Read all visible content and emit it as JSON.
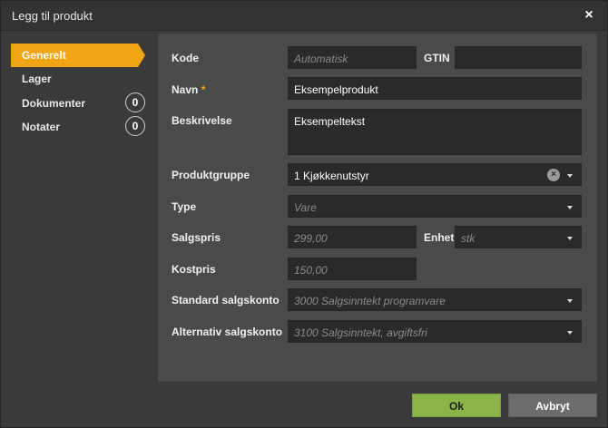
{
  "dialog": {
    "title": "Legg til produkt",
    "close_label": "×"
  },
  "sidebar": {
    "items": [
      {
        "label": "Generelt",
        "active": true
      },
      {
        "label": "Lager"
      },
      {
        "label": "Dokumenter",
        "count": "0"
      },
      {
        "label": "Notater",
        "count": "0"
      }
    ]
  },
  "form": {
    "kode": {
      "label": "Kode",
      "value": "",
      "placeholder": "Automatisk"
    },
    "gtin": {
      "label": "GTIN",
      "value": ""
    },
    "navn": {
      "label": "Navn",
      "required_marker": "*",
      "value": "Eksempelprodukt"
    },
    "beskrivelse": {
      "label": "Beskrivelse",
      "value": "Eksempeltekst"
    },
    "produktgruppe": {
      "label": "Produktgruppe",
      "value": "1 Kjøkkenutstyr",
      "clear_label": "×"
    },
    "type": {
      "label": "Type",
      "value": "",
      "placeholder": "Vare"
    },
    "salgspris": {
      "label": "Salgspris",
      "value": "",
      "placeholder": "299,00"
    },
    "enhet": {
      "label": "Enhet",
      "value": "",
      "placeholder": "stk"
    },
    "kostpris": {
      "label": "Kostpris",
      "value": "",
      "placeholder": "150,00"
    },
    "standard_salgskonto": {
      "label": "Standard salgskonto",
      "value": "",
      "placeholder": "3000 Salgsinntekt programvare"
    },
    "alternativ_salgskonto": {
      "label": "Alternativ salgskonto",
      "value": "",
      "placeholder": "3100 Salgsinntekt, avgiftsfri"
    }
  },
  "footer": {
    "ok_label": "Ok",
    "cancel_label": "Avbryt"
  },
  "colors": {
    "accent": "#f0a515",
    "ok_button": "#8ab448",
    "cancel_button": "#6c6c6c",
    "panel": "#4a4a4a",
    "field": "#2a2a2a"
  }
}
